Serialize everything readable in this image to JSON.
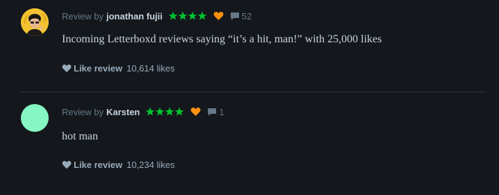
{
  "reviews": [
    {
      "attribution_prefix": "Review by",
      "author": "jonathan fujii",
      "rating_stars": 4,
      "liked": true,
      "comment_count": "52",
      "body": "Incoming Letterboxd reviews saying “it’s a hit, man!” with 25,000 likes",
      "like_label": "Like review",
      "like_count": "10,614 likes",
      "avatar_color": "#f2c230"
    },
    {
      "attribution_prefix": "Review by",
      "author": "Karsten",
      "rating_stars": 4,
      "liked": true,
      "comment_count": "1",
      "body": "hot man",
      "like_label": "Like review",
      "like_count": "10,234 likes",
      "avatar_color": "#86f7c4"
    }
  ],
  "colors": {
    "background": "#14181c",
    "star_green": "#00c030",
    "heart_orange": "#ff9010",
    "muted": "#678",
    "text": "#c8d4e0"
  },
  "icons": {
    "star": "star-icon",
    "liked_heart": "heart-icon",
    "comment": "comment-bubble-icon",
    "like_heart": "heart-icon"
  }
}
